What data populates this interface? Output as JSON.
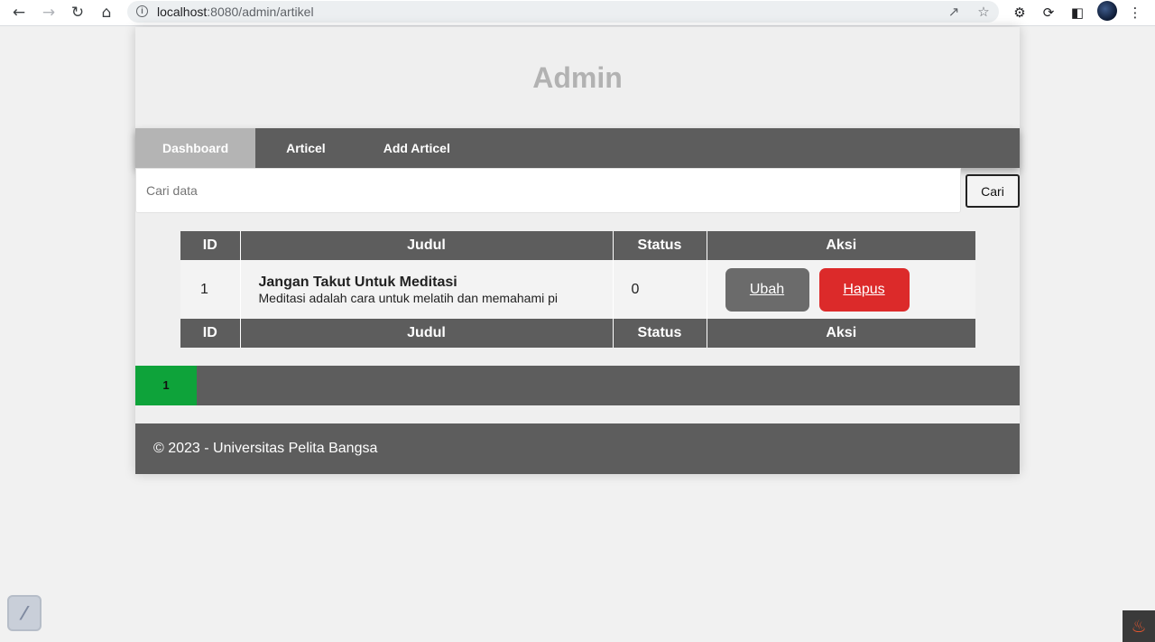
{
  "browser": {
    "url_host": "localhost",
    "url_path": ":8080/admin/artikel",
    "icons": [
      "back-arrow-icon",
      "forward-arrow-icon",
      "reload-icon",
      "home-icon",
      "info-icon",
      "share-icon",
      "star-icon",
      "puzzle-icon",
      "extension-icon",
      "sidebar-icon",
      "profile-avatar",
      "kebab-menu-icon"
    ]
  },
  "header": {
    "title": "Admin"
  },
  "nav": {
    "items": [
      {
        "label": "Dashboard",
        "active": true
      },
      {
        "label": "Articel",
        "active": false
      },
      {
        "label": "Add Articel",
        "active": false
      }
    ]
  },
  "search": {
    "placeholder": "Cari data",
    "value": "",
    "button_label": "Cari"
  },
  "table": {
    "headers": [
      "ID",
      "Judul",
      "Status",
      "Aksi"
    ],
    "footers": [
      "ID",
      "Judul",
      "Status",
      "Aksi"
    ],
    "rows": [
      {
        "id": "1",
        "title": "Jangan Takut Untuk Meditasi",
        "desc": "Meditasi adalah cara untuk melatih dan memahami pi",
        "status": "0",
        "edit_label": "Ubah",
        "delete_label": "Hapus"
      }
    ]
  },
  "pagination": {
    "pages": [
      "1"
    ],
    "current": "1"
  },
  "footer": {
    "text": "© 2023 - Universitas Pelita Bangsa"
  },
  "colors": {
    "nav_bg": "#5d5d5d",
    "nav_active": "#b4b4b4",
    "delete_btn": "#dc2a2a",
    "edit_btn": "#6b6b6b",
    "page_active": "#0ea33a",
    "title": "#b2b2b2"
  }
}
